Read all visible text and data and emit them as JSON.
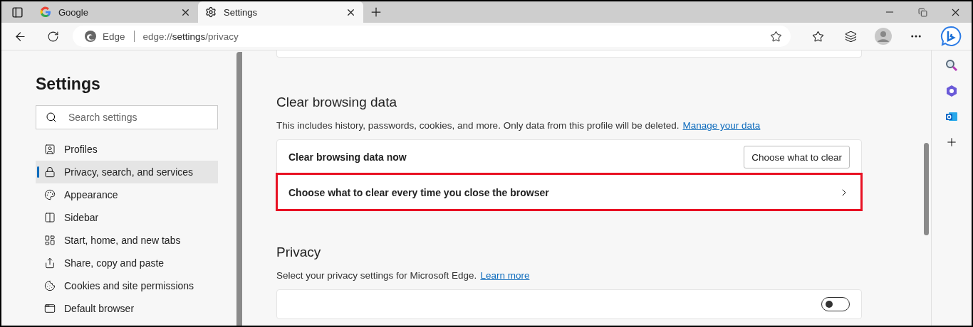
{
  "tabs": [
    {
      "kind": "google",
      "label": "Google",
      "selected": false
    },
    {
      "kind": "settings",
      "label": "Settings",
      "selected": true
    }
  ],
  "address_bar": {
    "site_label": "Edge",
    "url_prefix": "edge://",
    "url_bold": "settings",
    "url_suffix": "/privacy"
  },
  "sidebar": {
    "title": "Settings",
    "search": {
      "placeholder": "Search settings"
    },
    "items": [
      {
        "label": "Profiles",
        "selected": false
      },
      {
        "label": "Privacy, search, and services",
        "selected": true
      },
      {
        "label": "Appearance",
        "selected": false
      },
      {
        "label": "Sidebar",
        "selected": false
      },
      {
        "label": "Start, home, and new tabs",
        "selected": false
      },
      {
        "label": "Share, copy and paste",
        "selected": false
      },
      {
        "label": "Cookies and site permissions",
        "selected": false
      },
      {
        "label": "Default browser",
        "selected": false
      }
    ]
  },
  "sections": [
    {
      "title": "Clear browsing data",
      "description": "This includes history, passwords, cookies, and more. Only data from this profile will be deleted.",
      "link": "Manage your data",
      "rows": [
        {
          "kind": "button",
          "label": "Clear browsing data now",
          "button": "Choose what to clear",
          "highlighted": false
        },
        {
          "kind": "chevron",
          "label": "Choose what to clear every time you close the browser",
          "highlighted": true
        }
      ]
    },
    {
      "title": "Privacy",
      "description": "Select your privacy settings for Microsoft Edge.",
      "link": "Learn more",
      "rows": [
        {
          "kind": "toggle",
          "on": false,
          "highlighted": false
        }
      ]
    }
  ]
}
